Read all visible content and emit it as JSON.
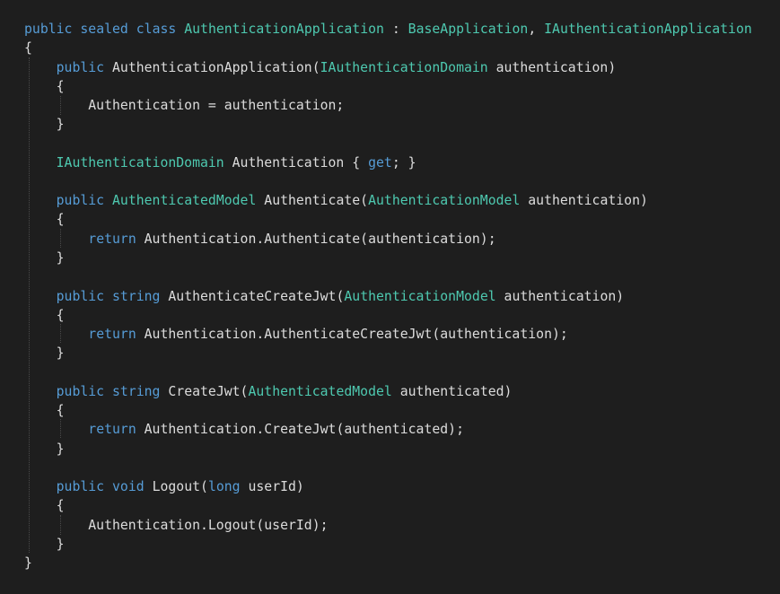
{
  "colors": {
    "background": "#1e1e1e",
    "keyword": "#569cd6",
    "type": "#4ec9b0",
    "text": "#dcdcdc",
    "indent_guide": "#4a4a4a"
  },
  "code_lines": [
    [
      {
        "t": "public",
        "c": "kw"
      },
      {
        "t": " ",
        "c": "tx"
      },
      {
        "t": "sealed",
        "c": "kw"
      },
      {
        "t": " ",
        "c": "tx"
      },
      {
        "t": "class",
        "c": "kw"
      },
      {
        "t": " ",
        "c": "tx"
      },
      {
        "t": "AuthenticationApplication",
        "c": "ty"
      },
      {
        "t": " : ",
        "c": "tx"
      },
      {
        "t": "BaseApplication",
        "c": "ty"
      },
      {
        "t": ", ",
        "c": "tx"
      },
      {
        "t": "IAuthenticationApplication",
        "c": "ty"
      }
    ],
    [
      {
        "t": "{",
        "c": "tx"
      }
    ],
    [
      {
        "t": "    ",
        "c": "tx"
      },
      {
        "t": "public",
        "c": "kw"
      },
      {
        "t": " AuthenticationApplication(",
        "c": "tx"
      },
      {
        "t": "IAuthenticationDomain",
        "c": "ty"
      },
      {
        "t": " authentication)",
        "c": "tx"
      }
    ],
    [
      {
        "t": "    {",
        "c": "tx"
      }
    ],
    [
      {
        "t": "        Authentication = authentication;",
        "c": "tx"
      }
    ],
    [
      {
        "t": "    }",
        "c": "tx"
      }
    ],
    [],
    [
      {
        "t": "    ",
        "c": "tx"
      },
      {
        "t": "IAuthenticationDomain",
        "c": "ty"
      },
      {
        "t": " Authentication { ",
        "c": "tx"
      },
      {
        "t": "get",
        "c": "kw"
      },
      {
        "t": "; }",
        "c": "tx"
      }
    ],
    [],
    [
      {
        "t": "    ",
        "c": "tx"
      },
      {
        "t": "public",
        "c": "kw"
      },
      {
        "t": " ",
        "c": "tx"
      },
      {
        "t": "AuthenticatedModel",
        "c": "ty"
      },
      {
        "t": " Authenticate(",
        "c": "tx"
      },
      {
        "t": "AuthenticationModel",
        "c": "ty"
      },
      {
        "t": " authentication)",
        "c": "tx"
      }
    ],
    [
      {
        "t": "    {",
        "c": "tx"
      }
    ],
    [
      {
        "t": "        ",
        "c": "tx"
      },
      {
        "t": "return",
        "c": "kw"
      },
      {
        "t": " Authentication.Authenticate(authentication);",
        "c": "tx"
      }
    ],
    [
      {
        "t": "    }",
        "c": "tx"
      }
    ],
    [],
    [
      {
        "t": "    ",
        "c": "tx"
      },
      {
        "t": "public",
        "c": "kw"
      },
      {
        "t": " ",
        "c": "tx"
      },
      {
        "t": "string",
        "c": "kw"
      },
      {
        "t": " AuthenticateCreateJwt(",
        "c": "tx"
      },
      {
        "t": "AuthenticationModel",
        "c": "ty"
      },
      {
        "t": " authentication)",
        "c": "tx"
      }
    ],
    [
      {
        "t": "    {",
        "c": "tx"
      }
    ],
    [
      {
        "t": "        ",
        "c": "tx"
      },
      {
        "t": "return",
        "c": "kw"
      },
      {
        "t": " Authentication.AuthenticateCreateJwt(authentication);",
        "c": "tx"
      }
    ],
    [
      {
        "t": "    }",
        "c": "tx"
      }
    ],
    [],
    [
      {
        "t": "    ",
        "c": "tx"
      },
      {
        "t": "public",
        "c": "kw"
      },
      {
        "t": " ",
        "c": "tx"
      },
      {
        "t": "string",
        "c": "kw"
      },
      {
        "t": " CreateJwt(",
        "c": "tx"
      },
      {
        "t": "AuthenticatedModel",
        "c": "ty"
      },
      {
        "t": " authenticated)",
        "c": "tx"
      }
    ],
    [
      {
        "t": "    {",
        "c": "tx"
      }
    ],
    [
      {
        "t": "        ",
        "c": "tx"
      },
      {
        "t": "return",
        "c": "kw"
      },
      {
        "t": " Authentication.CreateJwt(authenticated);",
        "c": "tx"
      }
    ],
    [
      {
        "t": "    }",
        "c": "tx"
      }
    ],
    [],
    [
      {
        "t": "    ",
        "c": "tx"
      },
      {
        "t": "public",
        "c": "kw"
      },
      {
        "t": " ",
        "c": "tx"
      },
      {
        "t": "void",
        "c": "kw"
      },
      {
        "t": " Logout(",
        "c": "tx"
      },
      {
        "t": "long",
        "c": "kw"
      },
      {
        "t": " userId)",
        "c": "tx"
      }
    ],
    [
      {
        "t": "    {",
        "c": "tx"
      }
    ],
    [
      {
        "t": "        Authentication.Logout(userId);",
        "c": "tx"
      }
    ],
    [
      {
        "t": "    }",
        "c": "tx"
      }
    ],
    [
      {
        "t": "}",
        "c": "tx"
      }
    ]
  ]
}
